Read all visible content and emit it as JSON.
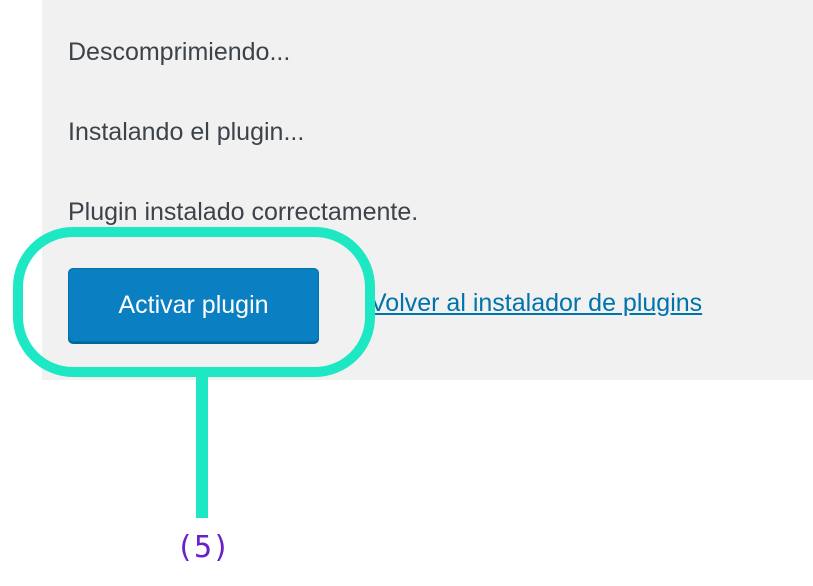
{
  "messages": [
    "Descomprimiendo...",
    "Instalando el plugin...",
    "Plugin instalado correctamente."
  ],
  "actions": {
    "activate_label": "Activar plugin",
    "back_link_label": "Volver al instalador de plugins"
  },
  "annotation": {
    "step_label": "(5)",
    "highlight_color": "#1ee8c4",
    "label_color": "#6a1fc9"
  },
  "colors": {
    "panel_background": "#f1f1f1",
    "button_background": "#0a7fc2",
    "link": "#0073aa"
  }
}
